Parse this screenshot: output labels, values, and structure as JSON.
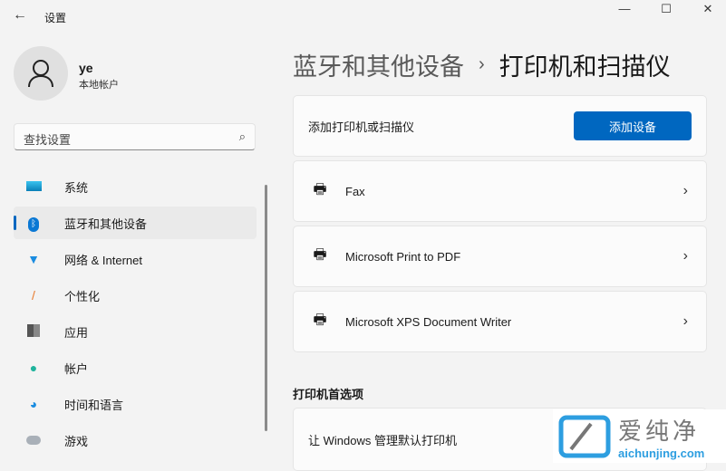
{
  "window": {
    "title": "设置",
    "back": "←",
    "minimize": "—",
    "maximize": "☐",
    "close": "✕"
  },
  "profile": {
    "name": "ye",
    "type": "本地帐户"
  },
  "search": {
    "placeholder": "查找设置"
  },
  "nav": [
    {
      "label": "系统",
      "icon": "monitor-icon",
      "active": false
    },
    {
      "label": "蓝牙和其他设备",
      "icon": "bluetooth-icon",
      "active": true
    },
    {
      "label": "网络 & Internet",
      "icon": "wifi-icon",
      "active": false
    },
    {
      "label": "个性化",
      "icon": "brush-icon",
      "active": false
    },
    {
      "label": "应用",
      "icon": "apps-icon",
      "active": false
    },
    {
      "label": "帐户",
      "icon": "person-icon",
      "active": false
    },
    {
      "label": "时间和语言",
      "icon": "clock-globe-icon",
      "active": false
    },
    {
      "label": "游戏",
      "icon": "gamepad-icon",
      "active": false
    }
  ],
  "breadcrumb": {
    "parent": "蓝牙和其他设备",
    "sep": "›",
    "current": "打印机和扫描仪"
  },
  "add": {
    "label": "添加打印机或扫描仪",
    "button": "添加设备"
  },
  "printers": [
    "Fax",
    "Microsoft Print to PDF",
    "Microsoft XPS Document Writer"
  ],
  "prefs": {
    "title": "打印机首选项",
    "item": "让 Windows 管理默认打印机"
  },
  "watermark": {
    "text": "爱纯净",
    "url": "aichunjing.com"
  }
}
